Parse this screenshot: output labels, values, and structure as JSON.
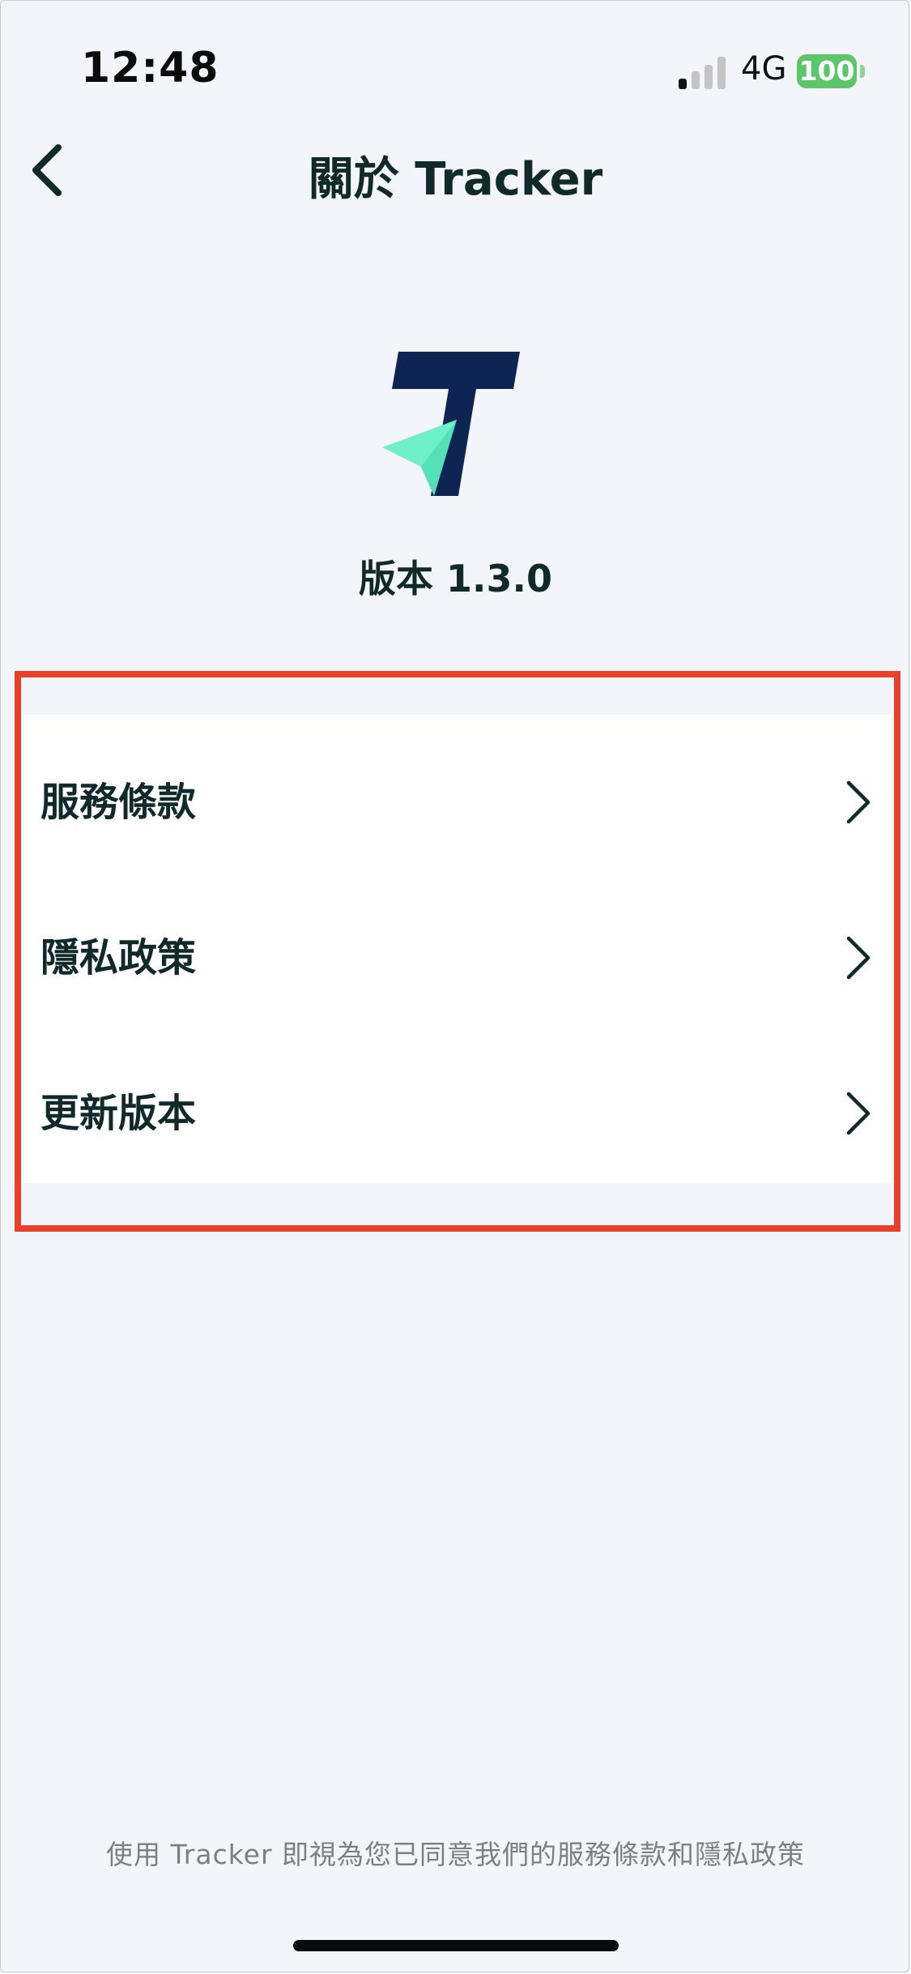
{
  "status_bar": {
    "time": "12:48",
    "network": "4G",
    "battery": "100"
  },
  "nav": {
    "back_icon": "chevron-left-icon",
    "title": "關於 Tracker"
  },
  "app": {
    "logo": "tracker-logo",
    "version": "版本 1.3.0"
  },
  "menu": {
    "items": [
      {
        "label": "服務條款",
        "icon": "chevron-right-icon"
      },
      {
        "label": "隱私政策",
        "icon": "chevron-right-icon"
      },
      {
        "label": "更新版本",
        "icon": "chevron-right-icon"
      }
    ]
  },
  "footer": {
    "text": "使用 Tracker 即視為您已同意我們的服務條款和隱私政策"
  },
  "colors": {
    "background": "#f3f5fa",
    "text": "#10292b",
    "logo_navy": "#0e2553",
    "logo_mint": "#6ff0c8",
    "highlight": "#e8412a",
    "battery": "#5cc66a"
  }
}
